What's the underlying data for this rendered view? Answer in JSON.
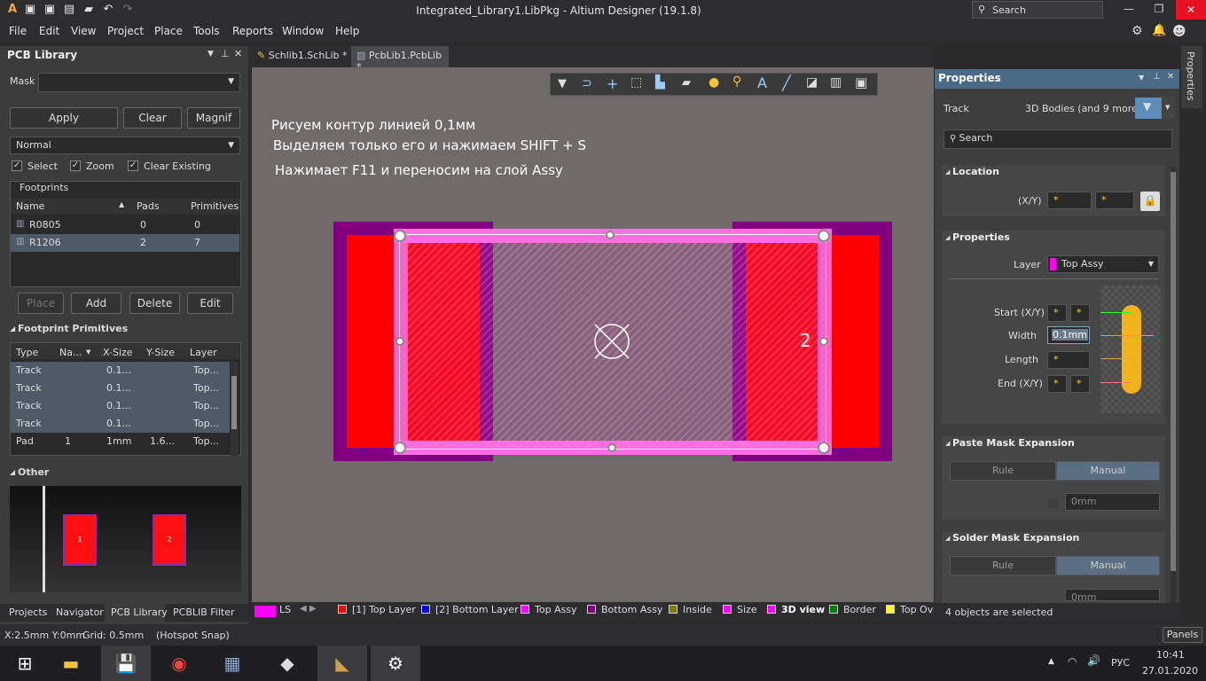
{
  "title": "Integrated_Library1.LibPkg - Altium Designer (19.1.8)",
  "title_search": "Search",
  "menu": [
    "File",
    "Edit",
    "View",
    "Project",
    "Place",
    "Tools",
    "Reports",
    "Window",
    "Help"
  ],
  "left_panel": {
    "title": "PCB Library",
    "mask_label": "Mask",
    "apply": "Apply",
    "clear": "Clear",
    "magnify": "Magnif",
    "mode": "Normal",
    "opt_select": "Select",
    "opt_zoom": "Zoom",
    "opt_clear_existing": "Clear Existing",
    "footprints_label": "Footprints",
    "fp_headers": [
      "Name",
      "Pads",
      "Primitives"
    ],
    "footprints": [
      {
        "name": "R0805",
        "pads": "0",
        "prims": "0"
      },
      {
        "name": "R1206",
        "pads": "2",
        "prims": "7"
      }
    ],
    "place": "Place",
    "add": "Add",
    "delete": "Delete",
    "edit": "Edit",
    "primitives_label": "Footprint Primitives",
    "prim_headers": [
      "Type",
      "Na...",
      "X-Size",
      "Y-Size",
      "Layer"
    ],
    "primitives": [
      {
        "type": "Track",
        "name": "",
        "x": "0.1...",
        "y": "",
        "layer": "Top..."
      },
      {
        "type": "Track",
        "name": "",
        "x": "0.1...",
        "y": "",
        "layer": "Top..."
      },
      {
        "type": "Track",
        "name": "",
        "x": "0.1...",
        "y": "",
        "layer": "Top..."
      },
      {
        "type": "Track",
        "name": "",
        "x": "0.1...",
        "y": "",
        "layer": "Top..."
      },
      {
        "type": "Pad",
        "name": "1",
        "x": "1mm",
        "y": "1.6...",
        "layer": "Top..."
      }
    ],
    "other_label": "Other",
    "preview_pad1": "1",
    "preview_pad2": "2",
    "bottom_tabs": [
      "Projects",
      "Navigator",
      "PCB Library",
      "PCBLIB Filter"
    ]
  },
  "doc_tabs": [
    "Schlib1.SchLib *",
    "PcbLib1.PcbLib *"
  ],
  "annotations": [
    "Рисуем контур линией  0,1мм",
    "Выделяем только его и нажимаем SHIFT + S",
    "Нажимает F11 и переносим на слой Assy"
  ],
  "canvas_labels": {
    "pad2": "2"
  },
  "layers": {
    "ls": "LS",
    "items": [
      {
        "name": "[1] Top Layer",
        "color": "#ff0000"
      },
      {
        "name": "[2] Bottom Layer",
        "color": "#0000ff"
      },
      {
        "name": "Top Assy",
        "color": "#ff00ff"
      },
      {
        "name": "Bottom Assy",
        "color": "#800080"
      },
      {
        "name": "Inside",
        "color": "#808000"
      },
      {
        "name": "Size",
        "color": "#ff00ff"
      },
      {
        "name": "3D view",
        "color": "#ff00ff"
      },
      {
        "name": "Border",
        "color": "#008000"
      },
      {
        "name": "Top Ov",
        "color": "#ffff00"
      }
    ]
  },
  "properties": {
    "title": "Properties",
    "object": "Track",
    "filter": "3D Bodies (and 9 more)",
    "search": "Search",
    "location": "Location",
    "xy_label": "(X/Y)",
    "xy_x": "*",
    "xy_y": "*",
    "props_label": "Properties",
    "layer_label": "Layer",
    "layer_value": "Top Assy",
    "layer_color": "#ff00ff",
    "start_label": "Start (X/Y)",
    "start_x": "*",
    "start_y": "*",
    "width_label": "Width",
    "width_value": "0.1mm",
    "length_label": "Length",
    "length_value": "*",
    "end_label": "End (X/Y)",
    "end_x": "*",
    "end_y": "*",
    "paste_label": "Paste Mask Expansion",
    "rule": "Rule",
    "manual": "Manual",
    "paste_value": "0mm",
    "solder_label": "Solder Mask Expansion",
    "solder_value": "0mm",
    "selected": "4 objects are selected",
    "side_tab": "Properties"
  },
  "status": {
    "coords": "X:2.5mm Y:0mm",
    "grid": "Grid: 0.5mm",
    "snap": "(Hotspot Snap)",
    "panels": "Panels"
  },
  "tray": {
    "lang": "РУС",
    "time": "10:41",
    "date": "27.01.2020"
  }
}
